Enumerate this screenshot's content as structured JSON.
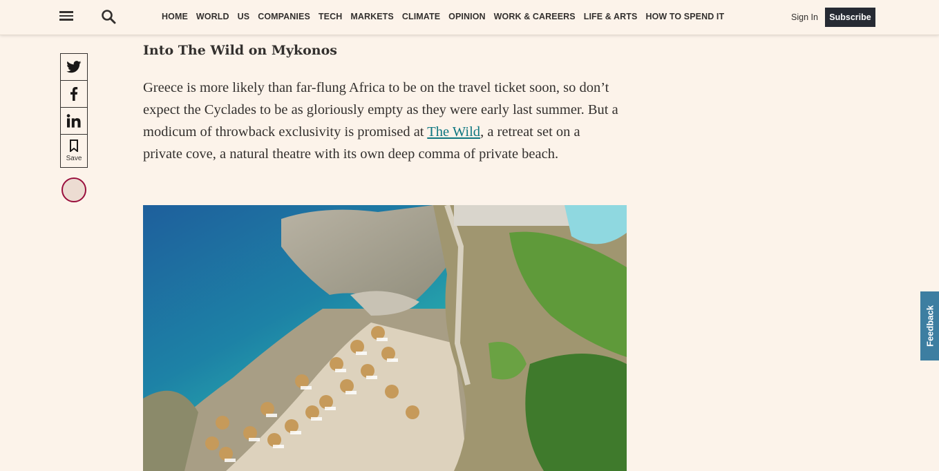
{
  "header": {
    "nav": [
      "HOME",
      "WORLD",
      "US",
      "COMPANIES",
      "TECH",
      "MARKETS",
      "CLIMATE",
      "OPINION",
      "WORK & CAREERS",
      "LIFE & ARTS",
      "HOW TO SPEND IT"
    ],
    "sign_in": "Sign In",
    "subscribe": "Subscribe"
  },
  "share": {
    "save_label": "Save"
  },
  "article": {
    "subheading": "Into The Wild on Mykonos",
    "para_before": "Greece is more likely than far-flung Africa to be on the travel ticket soon, so don’t expect the Cyclades to be as gloriously empty as they were early last summer. But a modicum of throwback exclusivity is promised at ",
    "link": "The Wild",
    "para_after": ", a retreat set on a private cove, a natural theatre with its own deep comma of private beach."
  },
  "feedback": "Feedback",
  "colors": {
    "background": "#fcf3ea",
    "link": "#0d7680",
    "subscribe_bg": "#262a33",
    "feedback_bg": "#3d7ea1",
    "progress_ring": "#990f3d"
  }
}
